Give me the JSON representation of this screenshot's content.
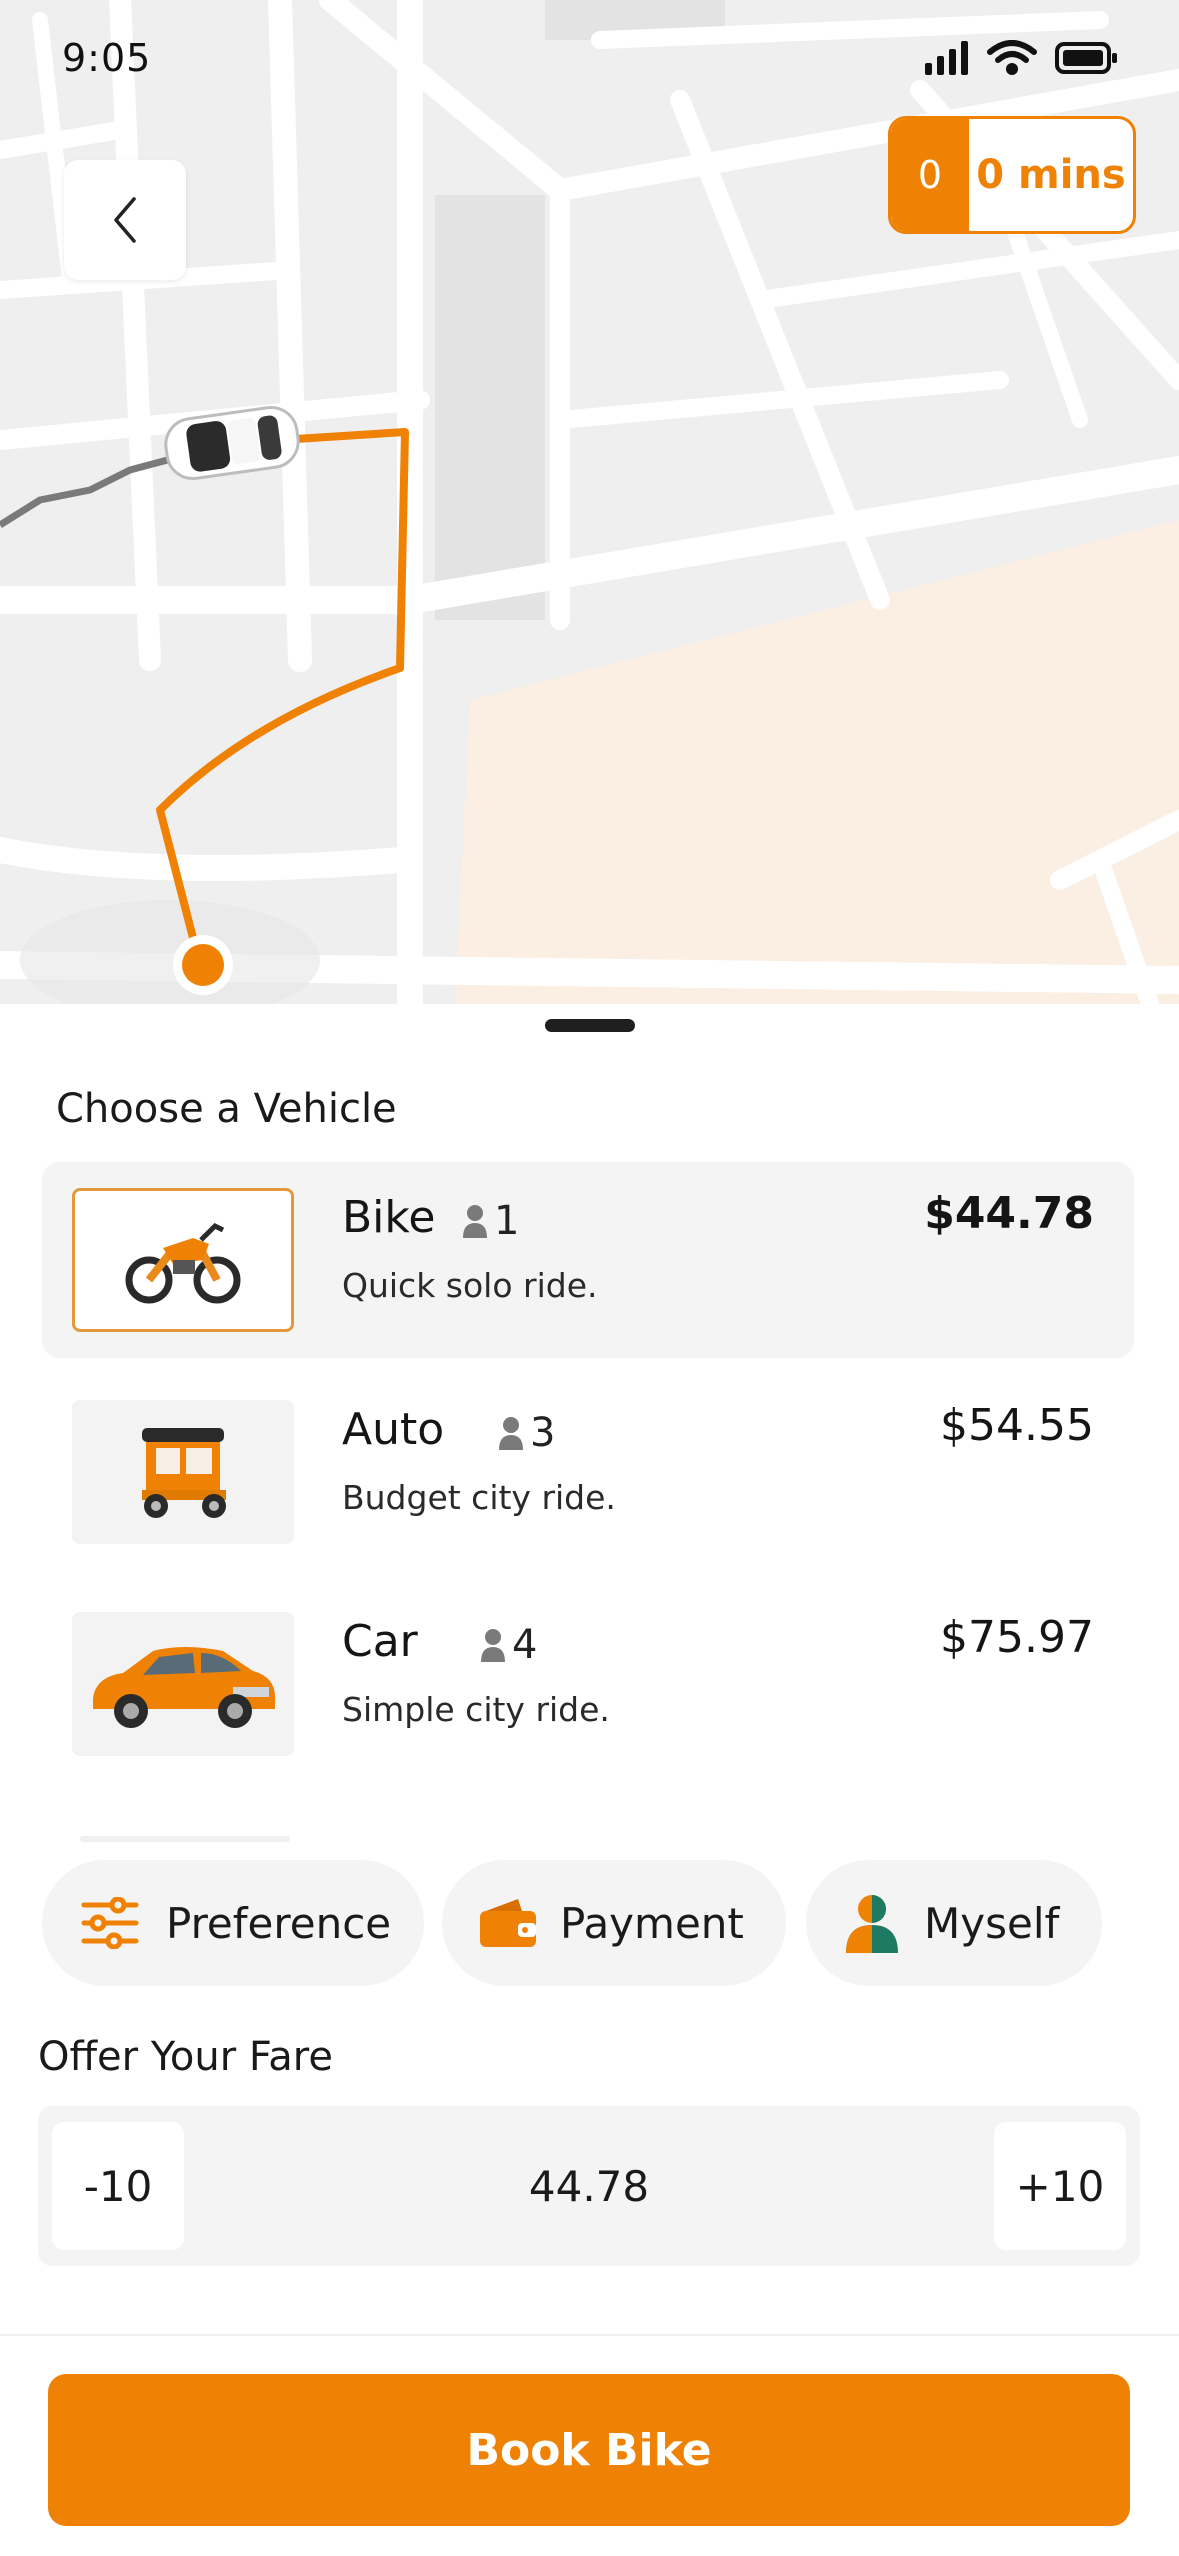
{
  "status_bar": {
    "time": "9:05"
  },
  "map": {
    "back_icon": "chevron-left-icon",
    "eta_count": "0",
    "eta_text": "0 mins",
    "accent_color": "#ef8104"
  },
  "sheet": {
    "title": "Choose a Vehicle",
    "vehicles": [
      {
        "name": "Bike",
        "capacity": "1",
        "description": "Quick solo ride.",
        "price": "$44.78",
        "selected": true,
        "icon": "motorbike-icon"
      },
      {
        "name": "Auto",
        "capacity": "3",
        "description": "Budget city ride.",
        "price": "$54.55",
        "selected": false,
        "icon": "auto-rickshaw-icon"
      },
      {
        "name": "Car",
        "capacity": "4",
        "description": "Simple city ride.",
        "price": "$75.97",
        "selected": false,
        "icon": "car-icon"
      }
    ],
    "chips": [
      {
        "label": "Preference",
        "icon": "sliders-icon"
      },
      {
        "label": "Payment",
        "icon": "wallet-icon"
      },
      {
        "label": "Myself",
        "icon": "person-icon"
      }
    ],
    "fare": {
      "title": "Offer Your Fare",
      "decrement_label": "-10",
      "value": "44.78",
      "increment_label": "+10"
    },
    "book_button_label": "Book Bike"
  }
}
